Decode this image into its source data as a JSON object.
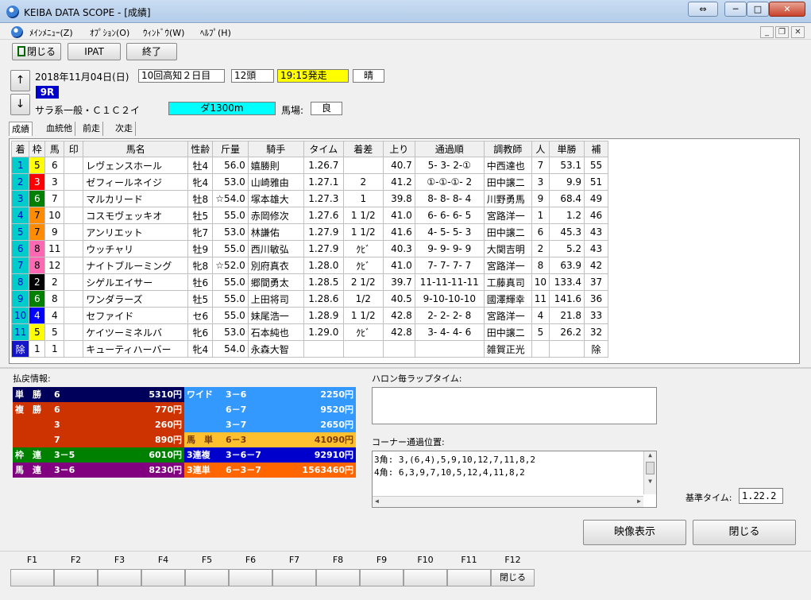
{
  "window": {
    "title": "KEIBA DATA SCOPE - [成績]",
    "btn_swap": "⇔",
    "btn_min": "─",
    "btn_max": "□",
    "btn_close": "✕"
  },
  "menu": {
    "items": [
      "ﾒｲﾝﾒﾆｭｰ(Z)",
      "ｵﾌﾟｼｮﾝ(O)",
      "ｳｨﾝﾄﾞｳ(W)",
      "ﾍﾙﾌﾟ(H)"
    ],
    "mdi_min": "_",
    "mdi_restore": "❐",
    "mdi_close": "✕"
  },
  "toolbar": {
    "close": "閉じる",
    "ipat": "IPAT",
    "exit": "終了"
  },
  "race": {
    "date": "2018年11月04日(日)",
    "meeting": "10回高知２日目",
    "runners": "12頭",
    "post_time": "19:15発走",
    "weather": "晴",
    "race_no": "9R",
    "class": "サラ系一般・Ｃ１Ｃ２イ",
    "course": "ダ1300m",
    "track_label": "馬場:",
    "track": "良",
    "up": "↑",
    "down": "↓"
  },
  "tabs": [
    "成績",
    "血統他",
    "前走",
    "次走"
  ],
  "columns": [
    "着",
    "枠",
    "馬",
    "印",
    "馬名",
    "性齢",
    "斤量",
    "騎手",
    "タイム",
    "着差",
    "上り",
    "通過順",
    "調教師",
    "人",
    "単勝",
    "補"
  ],
  "rows": [
    [
      "1",
      "5",
      "6",
      "",
      "レヴェンスホール",
      "牡4",
      "56.0",
      "嬉勝則",
      "1.26.7",
      "",
      "40.7",
      "5- 3- 2-①",
      "中西達也",
      "7",
      "53.1",
      "55"
    ],
    [
      "2",
      "3",
      "3",
      "",
      "ゼフィールネイジ",
      "牝4",
      "53.0",
      "山崎雅由",
      "1.27.1",
      "2",
      "41.2",
      "①-①-①- 2",
      "田中譲二",
      "3",
      "9.9",
      "51"
    ],
    [
      "3",
      "6",
      "7",
      "",
      "マルカリード",
      "牡8",
      "☆54.0",
      "塚本雄大",
      "1.27.3",
      "1",
      "39.8",
      "8- 8- 8- 4",
      "川野勇馬",
      "9",
      "68.4",
      "49"
    ],
    [
      "4",
      "7",
      "10",
      "",
      "コスモヴェッキオ",
      "牡5",
      "55.0",
      "赤岡修次",
      "1.27.6",
      "1 1/2",
      "41.0",
      "6- 6- 6- 5",
      "宮路洋一",
      "1",
      "1.2",
      "46"
    ],
    [
      "5",
      "7",
      "9",
      "",
      "アンリエット",
      "牝7",
      "53.0",
      "林謙佑",
      "1.27.9",
      "1 1/2",
      "41.6",
      "4- 5- 5- 3",
      "田中譲二",
      "6",
      "45.3",
      "43"
    ],
    [
      "6",
      "8",
      "11",
      "",
      "ウッチャリ",
      "牡9",
      "55.0",
      "西川敏弘",
      "1.27.9",
      "ｸﾋﾞ",
      "40.3",
      "9- 9- 9- 9",
      "大関吉明",
      "2",
      "5.2",
      "43"
    ],
    [
      "7",
      "8",
      "12",
      "",
      "ナイトブルーミング",
      "牝8",
      "☆52.0",
      "別府真衣",
      "1.28.0",
      "ｸﾋﾞ",
      "41.0",
      "7- 7- 7- 7",
      "宮路洋一",
      "8",
      "63.9",
      "42"
    ],
    [
      "8",
      "2",
      "2",
      "",
      "シゲルエイサー",
      "牡6",
      "55.0",
      "郷間勇太",
      "1.28.5",
      "2 1/2",
      "39.7",
      "11-11-11-11",
      "工藤真司",
      "10",
      "133.4",
      "37"
    ],
    [
      "9",
      "6",
      "8",
      "",
      "ワンダラーズ",
      "牡5",
      "55.0",
      "上田将司",
      "1.28.6",
      "1/2",
      "40.5",
      "9-10-10-10",
      "國澤輝幸",
      "11",
      "141.6",
      "36"
    ],
    [
      "10",
      "4",
      "4",
      "",
      "セファイド",
      "セ6",
      "55.0",
      "妹尾浩一",
      "1.28.9",
      "1 1/2",
      "42.8",
      "2- 2- 2- 8",
      "宮路洋一",
      "4",
      "21.8",
      "33"
    ],
    [
      "11",
      "5",
      "5",
      "",
      "ケイツーミネルバ",
      "牝6",
      "53.0",
      "石本純也",
      "1.29.0",
      "ｸﾋﾞ",
      "42.8",
      "3- 4- 4- 6",
      "田中譲二",
      "5",
      "26.2",
      "32"
    ],
    [
      "除",
      "1",
      "1",
      "",
      "キューティハーバー",
      "牝4",
      "54.0",
      "永森大智",
      "",
      "",
      "",
      "",
      "雑賀正光",
      "",
      "",
      "除"
    ]
  ],
  "colors": {
    "finish_cell": "#00cccc",
    "finish_excluded": "#1414c8",
    "waku": {
      "1": "#ffffff",
      "2": "#000000",
      "3": "#ff0000",
      "4": "#0000ff",
      "5": "#ffff00",
      "6": "#008000",
      "7": "#ff8c00",
      "8": "#ff69b4"
    }
  },
  "payout": {
    "label": "払戻情報:",
    "left": [
      {
        "name": "単　勝",
        "combo": "6",
        "amount": "5310円",
        "color": "#00005a"
      },
      {
        "name": "複　勝",
        "combo": "6",
        "amount": "770円",
        "color": "#cc3300"
      },
      {
        "name": "",
        "combo": "3",
        "amount": "260円",
        "color": "#cc3300"
      },
      {
        "name": "",
        "combo": "7",
        "amount": "890円",
        "color": "#cc3300"
      },
      {
        "name": "枠　連",
        "combo": "3－5",
        "amount": "6010円",
        "color": "#008000"
      },
      {
        "name": "馬　連",
        "combo": "3－6",
        "amount": "8230円",
        "color": "#800080"
      }
    ],
    "right": [
      {
        "name": "ワイド",
        "combo": "3－6",
        "amount": "2250円",
        "color": "#3399ff"
      },
      {
        "name": "",
        "combo": "6－7",
        "amount": "9520円",
        "color": "#3399ff"
      },
      {
        "name": "",
        "combo": "3－7",
        "amount": "2650円",
        "color": "#3399ff"
      },
      {
        "name": "馬　単",
        "combo": "6－3",
        "amount": "41090円",
        "color": "#ffc030"
      },
      {
        "name": "3連複",
        "combo": "3－6－7",
        "amount": "92910円",
        "color": "#0000cc"
      },
      {
        "name": "3連単",
        "combo": "6－3－7",
        "amount": "1563460円",
        "color": "#ff6600"
      }
    ]
  },
  "lap": {
    "label": "ハロン毎ラップタイム:",
    "value": ""
  },
  "corner": {
    "label": "コーナー通過位置:",
    "line1": "3角: 3,(6,4),5,9,10,12,7,11,8,2",
    "line2": "4角: 6,3,9,7,10,5,12,4,11,8,2"
  },
  "base_time": {
    "label": "基準タイム:",
    "value": "1.22.2"
  },
  "actions": {
    "video": "映像表示",
    "close": "閉じる"
  },
  "fkeys": [
    "F1",
    "F2",
    "F3",
    "F4",
    "F5",
    "F6",
    "F7",
    "F8",
    "F9",
    "F10",
    "F11",
    "F12"
  ],
  "fkey_f12_label": "閉じる"
}
